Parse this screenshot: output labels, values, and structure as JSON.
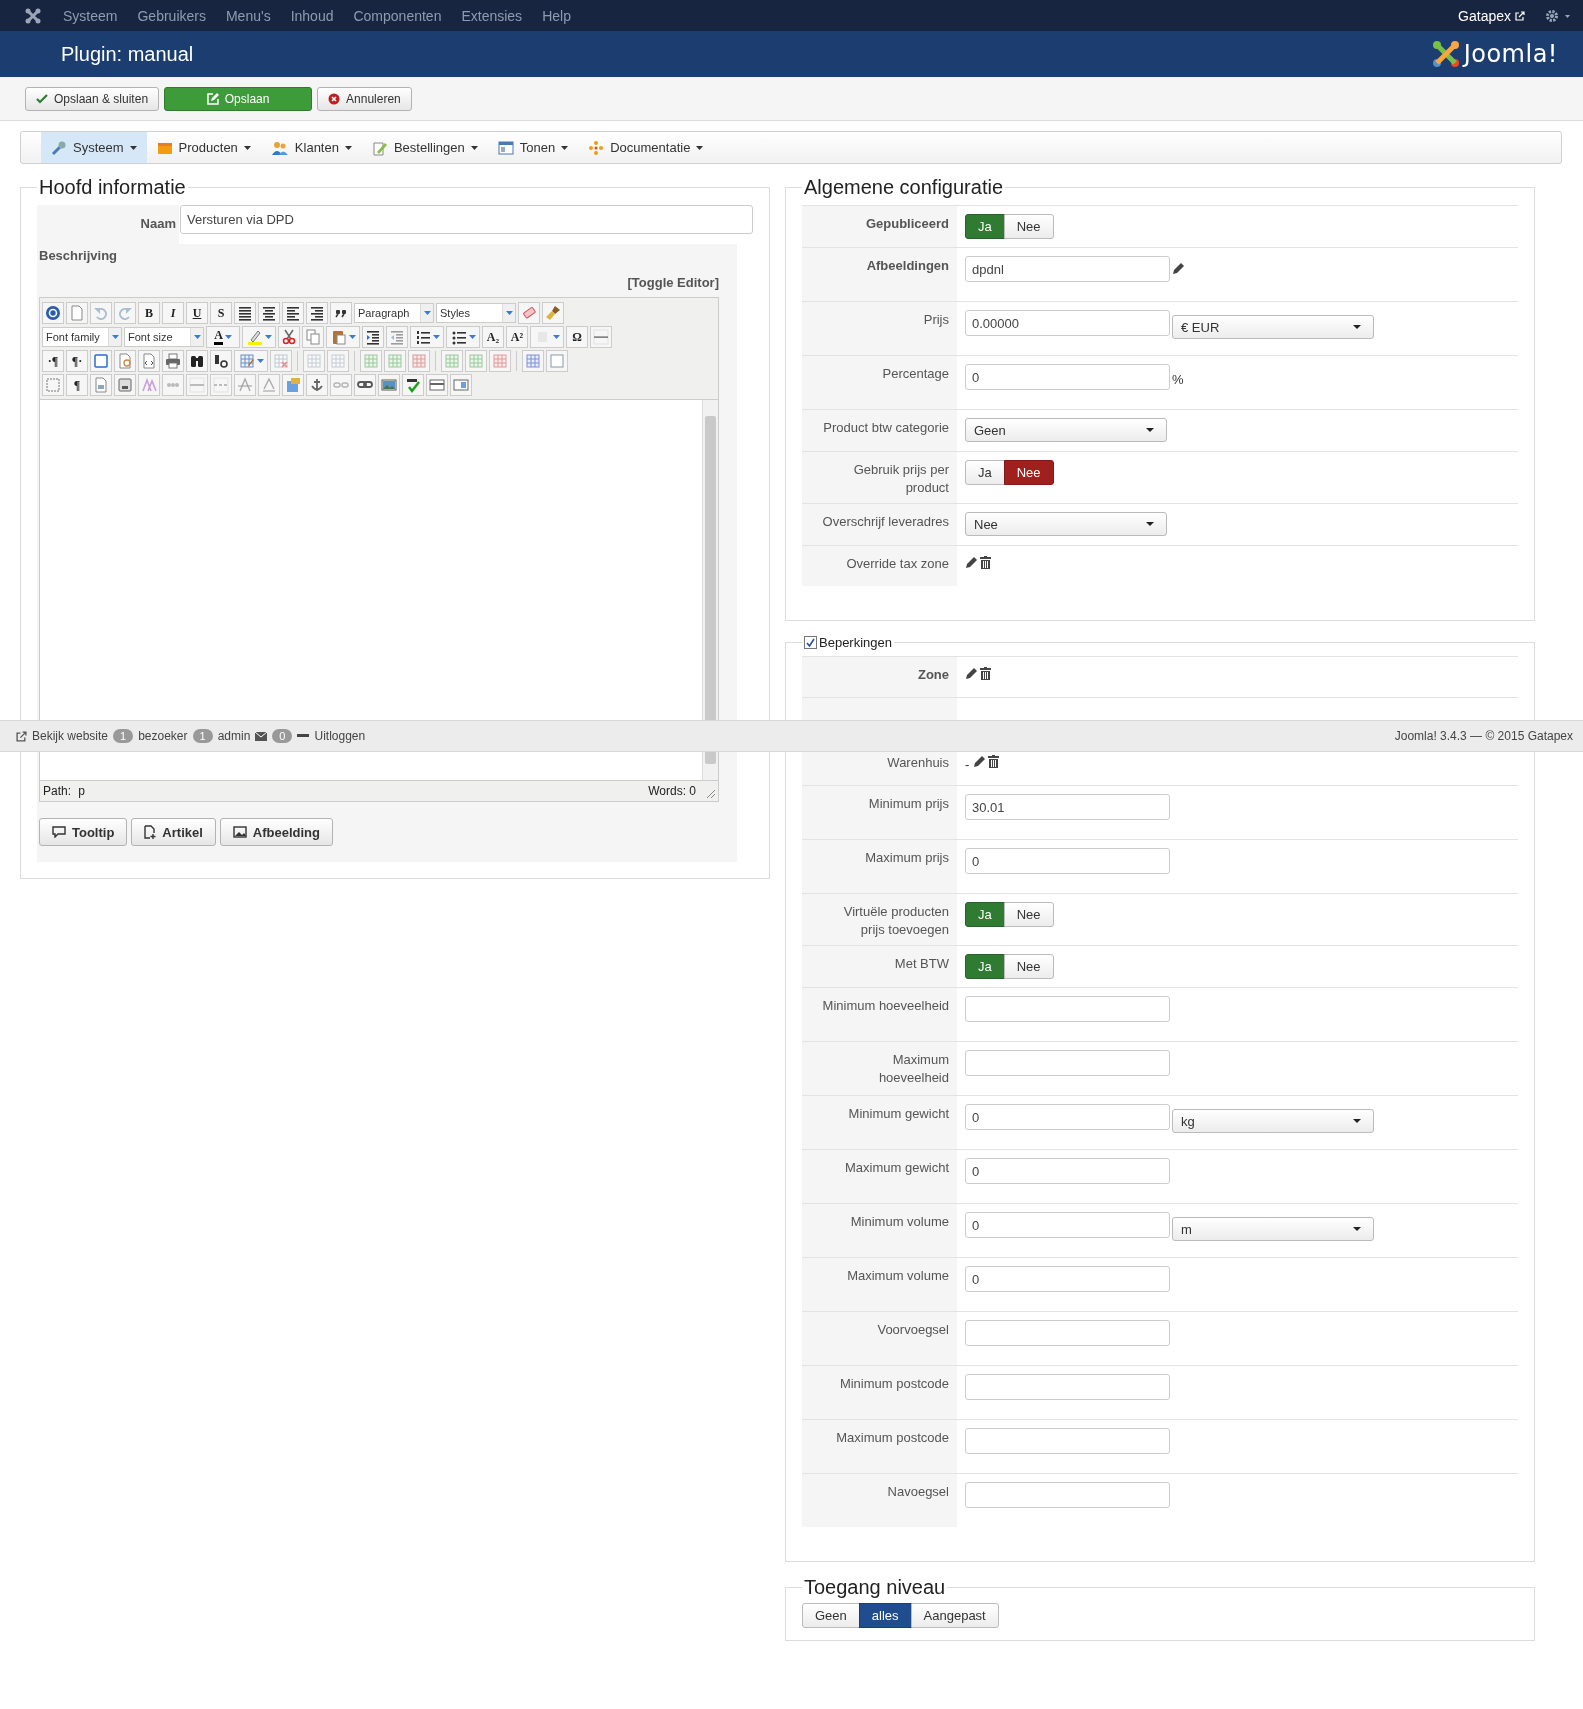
{
  "top_menu": {
    "items": [
      "Systeem",
      "Gebruikers",
      "Menu's",
      "Inhoud",
      "Componenten",
      "Extensies",
      "Help"
    ],
    "user": "Gatapex"
  },
  "header": {
    "title": "Plugin: manual",
    "logo_text": "Joomla!"
  },
  "toolbar": [
    {
      "label": "Opslaan & sluiten",
      "kind": "save_close"
    },
    {
      "label": "Opslaan",
      "kind": "save"
    },
    {
      "label": "Annuleren",
      "kind": "cancel"
    }
  ],
  "component_menu": [
    {
      "label": "Systeem",
      "selected": true
    },
    {
      "label": "Producten",
      "selected": false
    },
    {
      "label": "Klanten",
      "selected": false
    },
    {
      "label": "Bestellingen",
      "selected": false
    },
    {
      "label": "Tonen",
      "selected": false
    },
    {
      "label": "Documentatie",
      "selected": false
    }
  ],
  "main_info": {
    "legend": "Hoofd informatie",
    "name_label": "Naam",
    "name_value": "Versturen via DPD",
    "description_label": "Beschrijving",
    "toggle_editor": "[Toggle Editor]",
    "editor": {
      "glyphs": [
        "B",
        "I",
        "U",
        "S",
        "A",
        "A₂",
        "A²",
        "Ω",
        "·¶",
        "¶·",
        "¶"
      ],
      "format": "Paragraph",
      "styles": "Styles",
      "font_family": "Font family",
      "font_size": "Font size",
      "path_label": "Path:",
      "path": "p",
      "words": "Words: 0"
    },
    "buttons": [
      {
        "label": "Tooltip",
        "kind": "tooltip"
      },
      {
        "label": "Artikel",
        "kind": "article"
      },
      {
        "label": "Afbeelding",
        "kind": "image"
      }
    ]
  },
  "general_config": {
    "legend": "Algemene configuratie",
    "rows": [
      {
        "label": "Gepubliceerd",
        "strong": true,
        "kind": "toggle",
        "options": [
          {
            "label": "Ja",
            "selected": true
          },
          {
            "label": "Nee",
            "selected": false
          }
        ]
      },
      {
        "label": "Afbeeldingen",
        "strong": true,
        "kind": "text_edit",
        "value": "dpdnl"
      },
      {
        "label": "Prijs",
        "strong": false,
        "kind": "text_select",
        "value": "0.00000",
        "select": "€ EUR"
      },
      {
        "label": "Percentage",
        "strong": false,
        "kind": "text_suffix",
        "value": "0",
        "suffix": "%"
      },
      {
        "label": "Product btw categorie",
        "strong": false,
        "kind": "select",
        "select": "Geen"
      },
      {
        "label": "Gebruik prijs per product",
        "strong": false,
        "kind": "toggle",
        "options": [
          {
            "label": "Ja",
            "selected": false
          },
          {
            "label": "Nee",
            "selected": true
          }
        ]
      },
      {
        "label": "Overschrijf leveradres",
        "strong": false,
        "kind": "select",
        "select": "Nee"
      },
      {
        "label": "Override tax zone",
        "strong": false,
        "kind": "icons"
      }
    ]
  },
  "restrictions": {
    "legend": "Beperkingen",
    "checked": true,
    "rows": [
      {
        "label": "Zone",
        "strong": true,
        "kind": "icons"
      },
      {
        "kind": "obscured"
      },
      {
        "label": "Warenhuis",
        "strong": false,
        "kind": "dash_icons",
        "prefix": "-"
      },
      {
        "label": "Minimum prijs",
        "strong": false,
        "kind": "text",
        "value": "30.01"
      },
      {
        "label": "Maximum prijs",
        "strong": false,
        "kind": "text",
        "value": "0"
      },
      {
        "label": "Virtuële producten prijs toevoegen",
        "strong": false,
        "kind": "toggle",
        "options": [
          {
            "label": "Ja",
            "selected": true
          },
          {
            "label": "Nee",
            "selected": false
          }
        ]
      },
      {
        "label": "Met BTW",
        "strong": false,
        "kind": "toggle",
        "options": [
          {
            "label": "Ja",
            "selected": true
          },
          {
            "label": "Nee",
            "selected": false
          }
        ]
      },
      {
        "label": "Minimum hoeveelheid",
        "strong": false,
        "kind": "text"
      },
      {
        "label": "Maximum hoeveelheid",
        "strong": false,
        "kind": "text"
      },
      {
        "label": "Minimum gewicht",
        "strong": false,
        "kind": "text_select",
        "value": "0",
        "select": "kg"
      },
      {
        "label": "Maximum gewicht",
        "strong": false,
        "kind": "text",
        "value": "0"
      },
      {
        "label": "Minimum volume",
        "strong": false,
        "kind": "text_select",
        "value": "0",
        "select": "m"
      },
      {
        "label": "Maximum volume",
        "strong": false,
        "kind": "text",
        "value": "0"
      },
      {
        "label": "Voorvoegsel",
        "strong": false,
        "kind": "text"
      },
      {
        "label": "Minimum postcode",
        "strong": false,
        "kind": "text"
      },
      {
        "label": "Maximum postcode",
        "strong": false,
        "kind": "text"
      },
      {
        "label": "Navoegsel",
        "strong": false,
        "kind": "text"
      }
    ]
  },
  "access": {
    "legend": "Toegang niveau",
    "options": [
      {
        "label": "Geen",
        "selected": false
      },
      {
        "label": "alles",
        "selected": true
      },
      {
        "label": "Aangepast",
        "selected": false
      }
    ]
  },
  "status_bar": {
    "view_site": "Bekijk website",
    "visitors": "1",
    "visitors_label": "bezoeker",
    "admins": "1",
    "admins_label": "admin",
    "messages": "0",
    "logout": "Uitloggen",
    "version": "Joomla! 3.4.3 — © 2015 Gatapex"
  }
}
